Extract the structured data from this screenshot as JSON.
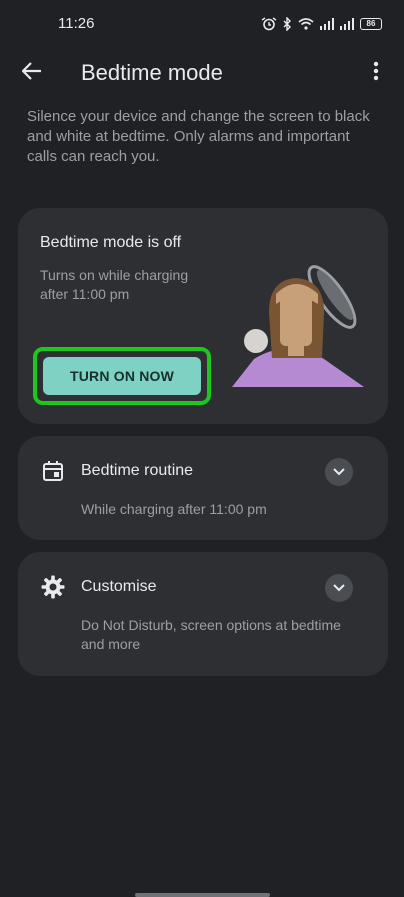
{
  "status_bar": {
    "time": "11:26",
    "battery": "86"
  },
  "header": {
    "title": "Bedtime mode",
    "back_icon": "arrow-back-icon",
    "overflow_icon": "more-vert-icon"
  },
  "description": "Silence your device and change the screen to black and white at bedtime. Only alarms and important calls can reach you.",
  "status_card": {
    "title": "Bedtime mode is off",
    "subtitle": "Turns on while charging after 11:00 pm",
    "button_label": "TURN ON NOW",
    "highlight_color": "#1ec71e",
    "button_color": "#7fd1c3"
  },
  "routine_card": {
    "icon": "calendar-icon",
    "title": "Bedtime routine",
    "subtitle": "While charging after 11:00 pm",
    "expand_icon": "chevron-down-icon"
  },
  "customise_card": {
    "icon": "gear-icon",
    "title": "Customise",
    "subtitle": "Do Not Disturb, screen options at bedtime and more",
    "expand_icon": "chevron-down-icon"
  },
  "colors": {
    "background": "#202124",
    "card": "#2d2f33",
    "accent": "#7fd1c3"
  }
}
